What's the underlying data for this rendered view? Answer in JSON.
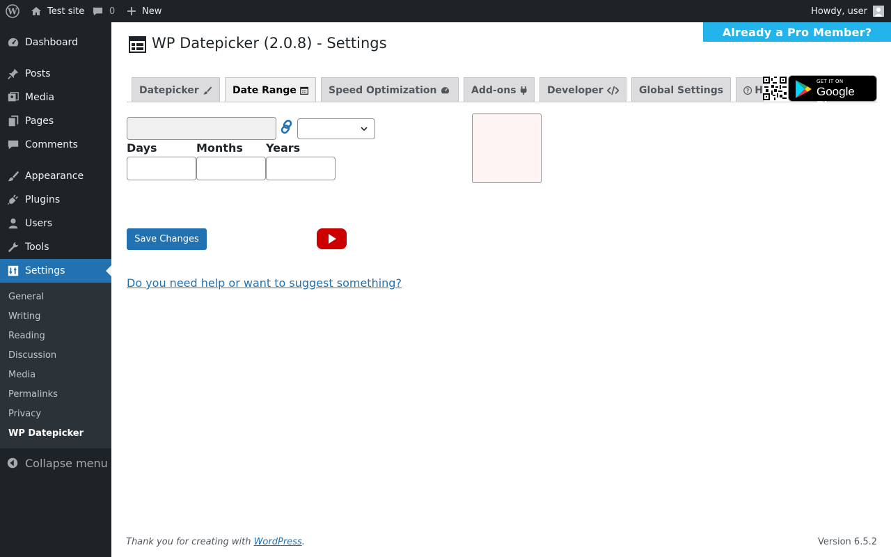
{
  "adminbar": {
    "site_name": "Test site",
    "comments_count": "0",
    "new_label": "New",
    "howdy": "Howdy, user"
  },
  "sidebar": {
    "items": [
      {
        "label": "Dashboard",
        "icon": "dashboard-icon"
      },
      {
        "label": "Posts",
        "icon": "pin-icon"
      },
      {
        "label": "Media",
        "icon": "media-icon"
      },
      {
        "label": "Pages",
        "icon": "pages-icon"
      },
      {
        "label": "Comments",
        "icon": "comment-icon"
      },
      {
        "label": "Appearance",
        "icon": "brush-icon"
      },
      {
        "label": "Plugins",
        "icon": "plug-icon"
      },
      {
        "label": "Users",
        "icon": "user-icon"
      },
      {
        "label": "Tools",
        "icon": "wrench-icon"
      },
      {
        "label": "Settings",
        "icon": "settings-icon"
      }
    ],
    "submenu": [
      "General",
      "Writing",
      "Reading",
      "Discussion",
      "Media",
      "Permalinks",
      "Privacy",
      "WP Datepicker"
    ],
    "collapse": "Collapse menu"
  },
  "page": {
    "title": "WP Datepicker (2.0.8) - Settings",
    "pro_banner": "Already a Pro Member?"
  },
  "tabs": [
    {
      "label": "Datepicker",
      "icon": "brush-icon"
    },
    {
      "label": "Date Range",
      "icon": "calendar-icon"
    },
    {
      "label": "Speed Optimization",
      "icon": "dashboard-icon"
    },
    {
      "label": "Add-ons",
      "icon": "plug-icon"
    },
    {
      "label": "Developer",
      "icon": "code-icon"
    },
    {
      "label": "Global Settings",
      "icon": ""
    },
    {
      "label": "H",
      "icon": "help-icon"
    }
  ],
  "google_play": {
    "small": "GET IT ON",
    "big": "Google Play"
  },
  "form": {
    "days_label": "Days",
    "months_label": "Months",
    "years_label": "Years",
    "save_label": "Save Changes",
    "help_link": "Do you need help or want to suggest something?"
  },
  "footer": {
    "thanks_prefix": "Thank you for creating with ",
    "wordpress_link": "WordPress",
    "thanks_suffix": ".",
    "version": "Version 6.5.2"
  },
  "colors": {
    "admin_dark": "#1d2327",
    "accent": "#2271b1",
    "pro_banner": "#22b4ea",
    "youtube_red": "#cc0000"
  }
}
